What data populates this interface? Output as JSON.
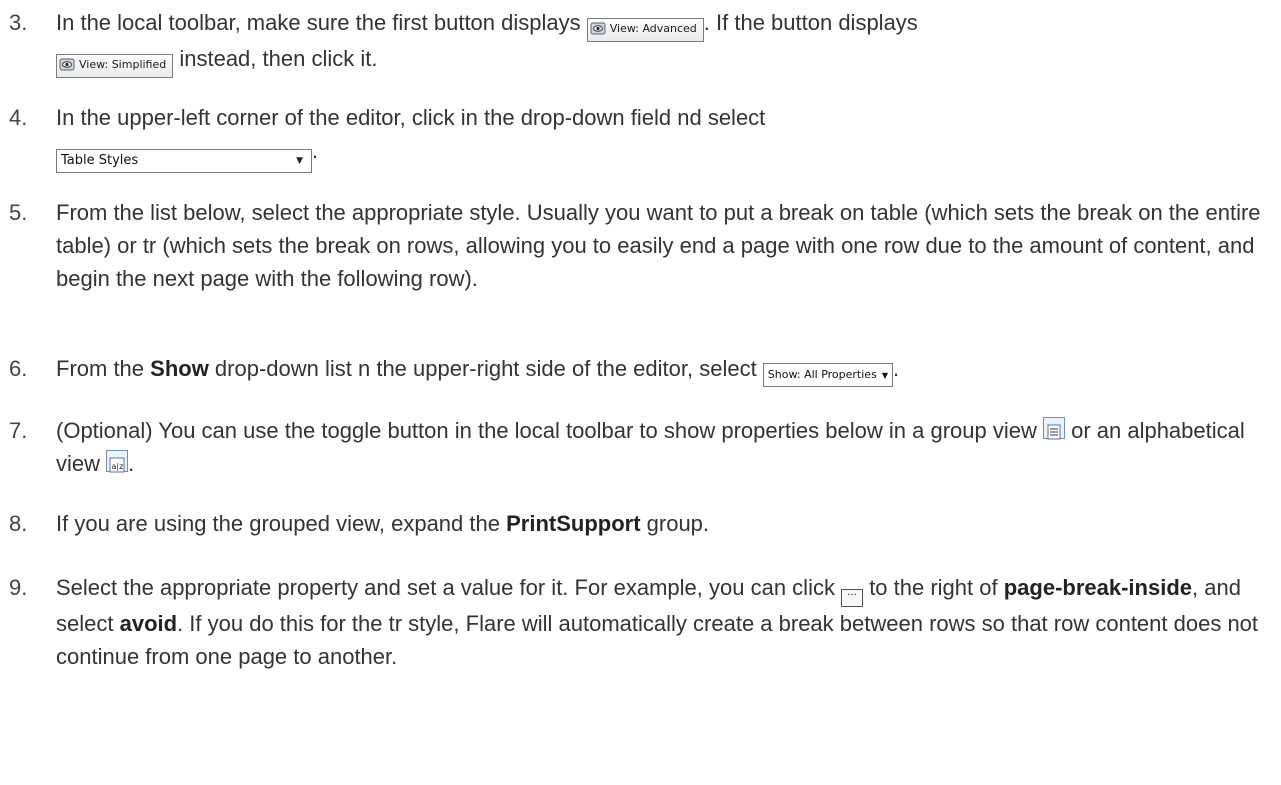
{
  "steps": [
    {
      "number": "3.",
      "text_a": "In the local toolbar, make sure the first button displays ",
      "button_advanced": "View: Advanced",
      "text_b": ". If the button displays ",
      "button_simplified": "View: Simplified",
      "text_c": " instead, then click it."
    },
    {
      "number": "4.",
      "text_a": "In the upper-left corner of the editor, click in the drop-down field  nd select",
      "dropdown_value": "Table Styles",
      "text_b": "."
    },
    {
      "number": "5.",
      "text": "From the list below, select the appropriate style. Usually you want to put a break on table (which sets the break on the entire table) or tr (which sets the break on rows, allowing you to easily end a page with one row due to the amount of content, and begin the next page with the following row)."
    },
    {
      "number": "6.",
      "text_a": "From the ",
      "bold_show": "Show",
      "text_b": " drop-down list  n the upper-right side of the editor, select ",
      "show_dropdown": "Show: All Properties",
      "text_c": "."
    },
    {
      "number": "7.",
      "text_a": "(Optional) You can use the toggle button in the local toolbar to show properties below in a group view ",
      "group_view_icon": "group-view-icon",
      "text_b": " or an alphabetical view ",
      "alpha_view_icon": "alphabetical-view-icon",
      "text_c": "."
    },
    {
      "number": "8.",
      "text_a": "If you are using the grouped view, expand the ",
      "bold_group": "PrintSupport",
      "text_b": " group."
    },
    {
      "number": "9.",
      "text_a": "Select the appropriate property and set a value for it. For example, you can click ",
      "ellipsis_label": "···",
      "text_b": " to the right of ",
      "bold_property": "page-break-inside",
      "text_c": ", and select ",
      "bold_value": "avoid",
      "text_d": ". If you do this for the tr style, Flare will automatically create a break between rows so that row content does not continue from one page to another."
    }
  ],
  "colors": {
    "text": "#333333",
    "border": "#7a7a7a",
    "icon_blue": "#6e8fb3"
  }
}
